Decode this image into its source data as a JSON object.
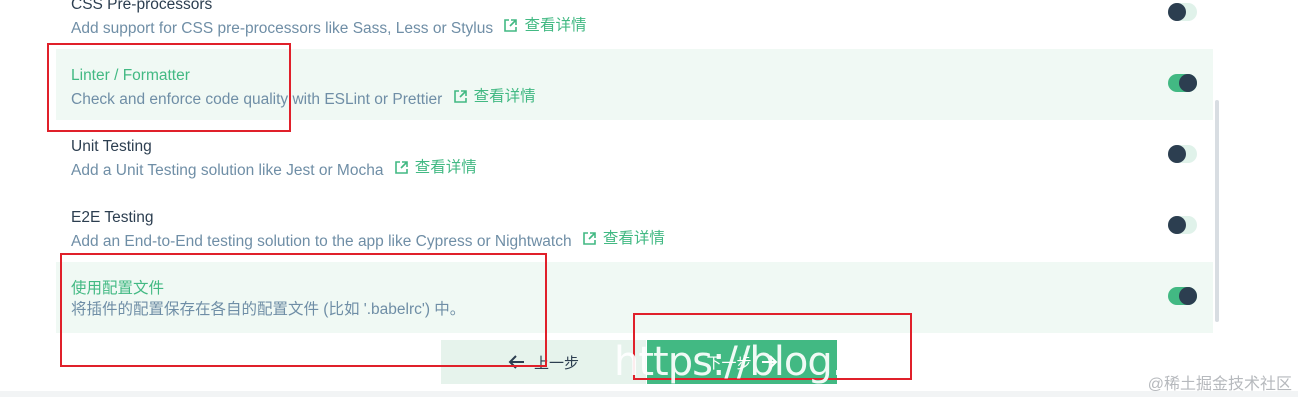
{
  "features": [
    {
      "name": "CSS Pre-processors",
      "description": "Add support for CSS pre-processors like Sass, Less or Stylus",
      "link_label": "查看详情",
      "selected": false,
      "enabled": false
    },
    {
      "name": "Linter / Formatter",
      "description": "Check and enforce code quality with ESLint or Prettier",
      "link_label": "查看详情",
      "selected": true,
      "enabled": true
    },
    {
      "name": "Unit Testing",
      "description": "Add a Unit Testing solution like Jest or Mocha",
      "link_label": "查看详情",
      "selected": false,
      "enabled": false
    },
    {
      "name": "E2E Testing",
      "description": "Add an End-to-End testing solution to the app like Cypress or Nightwatch",
      "link_label": "查看详情",
      "selected": false,
      "enabled": false
    },
    {
      "name": "使用配置文件",
      "description": "将插件的配置保存在各自的配置文件 (比如 '.babelrc') 中。",
      "link_label": "",
      "selected": true,
      "enabled": true
    }
  ],
  "footer": {
    "prev_label": "上一步",
    "next_label": "下一步"
  },
  "watermark": {
    "url_text": "https://blog.c",
    "site_text": "@稀土掘金技术社区"
  },
  "colors": {
    "accent": "#42b983",
    "dark": "#2c3e50",
    "selected_bg": "#f0f9f4",
    "annotation": "#e0202a"
  }
}
